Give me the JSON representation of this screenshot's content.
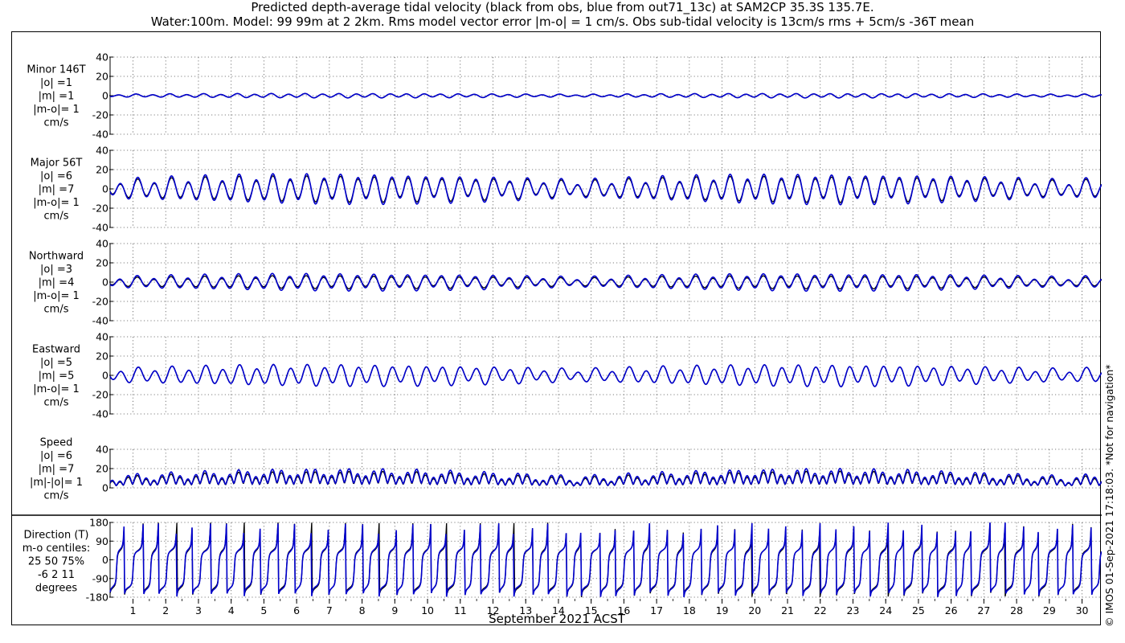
{
  "title": {
    "line1": "Predicted depth-average tidal velocity (black from obs, blue from out71_13c) at SAM2CP 35.3S 135.7E.",
    "line2": "Water:100m. Model: 99 99m at 2 2km. Rms model vector error |m-o| = 1 cm/s. Obs sub-tidal velocity is 13cm/s rms + 5cm/s -36T mean"
  },
  "copyright": "© IMOS 01-Sep-2021 17:18:03. *Not for navigation*",
  "colors": {
    "obs": "#000000",
    "model": "#0000cc",
    "grid": "#555555"
  },
  "chart_data": {
    "type": "line",
    "xlabel": "September 2021 ACST",
    "x_ticks": [
      "1",
      "2",
      "3",
      "4",
      "5",
      "6",
      "7",
      "8",
      "9",
      "10",
      "11",
      "12",
      "13",
      "14",
      "15",
      "16",
      "17",
      "18",
      "19",
      "20",
      "21",
      "22",
      "23",
      "24",
      "25",
      "26",
      "27",
      "28",
      "29",
      "30"
    ],
    "x_range_days": [
      0.3,
      30.6
    ],
    "legend": "none (series described in title)",
    "grid": "dotted",
    "series_names": [
      "obs",
      "model"
    ],
    "panels": [
      {
        "id": "minor",
        "label_lines": [
          "Minor 146T",
          "|o| =1",
          "|m| =1",
          "|m-o|= 1",
          "cm/s"
        ],
        "ylim": [
          -40,
          40
        ],
        "yticks": [
          40,
          20,
          0,
          -20,
          -40
        ],
        "amplitude_obs": 1,
        "amplitude_model": 1
      },
      {
        "id": "major",
        "label_lines": [
          "Major 56T",
          "|o| =6",
          "|m| =7",
          "|m-o|= 1",
          "cm/s"
        ],
        "ylim": [
          -40,
          40
        ],
        "yticks": [
          40,
          20,
          0,
          -20,
          -40
        ],
        "amplitude_obs": 6,
        "amplitude_model": 7
      },
      {
        "id": "northward",
        "label_lines": [
          "Northward",
          "|o| =3",
          "|m| =4",
          "|m-o|= 1",
          "cm/s"
        ],
        "ylim": [
          -40,
          40
        ],
        "yticks": [
          40,
          20,
          0,
          -20,
          -40
        ],
        "amplitude_obs": 3,
        "amplitude_model": 4
      },
      {
        "id": "eastward",
        "label_lines": [
          "Eastward",
          "|o| =5",
          "|m| =5",
          "|m-o|= 1",
          "cm/s"
        ],
        "ylim": [
          -40,
          40
        ],
        "yticks": [
          40,
          20,
          0,
          -20,
          -40
        ],
        "amplitude_obs": 5,
        "amplitude_model": 5
      },
      {
        "id": "speed",
        "label_lines": [
          "Speed",
          "|o| =6",
          "|m| =7",
          "|m|-|o|= 1",
          "cm/s"
        ],
        "ylim": [
          0,
          40
        ],
        "yticks": [
          40,
          20,
          0
        ],
        "amplitude_obs": 6,
        "amplitude_model": 7
      },
      {
        "id": "direction",
        "label_lines": [
          "Direction (T)",
          "m-o centiles:",
          "25  50  75%",
          "-6   2  11",
          "degrees"
        ],
        "ylim": [
          -180,
          180
        ],
        "yticks": [
          180,
          90,
          0,
          -90,
          -180
        ],
        "centiles": {
          "p25": -6,
          "p50": 2,
          "p75": 11
        }
      }
    ]
  }
}
